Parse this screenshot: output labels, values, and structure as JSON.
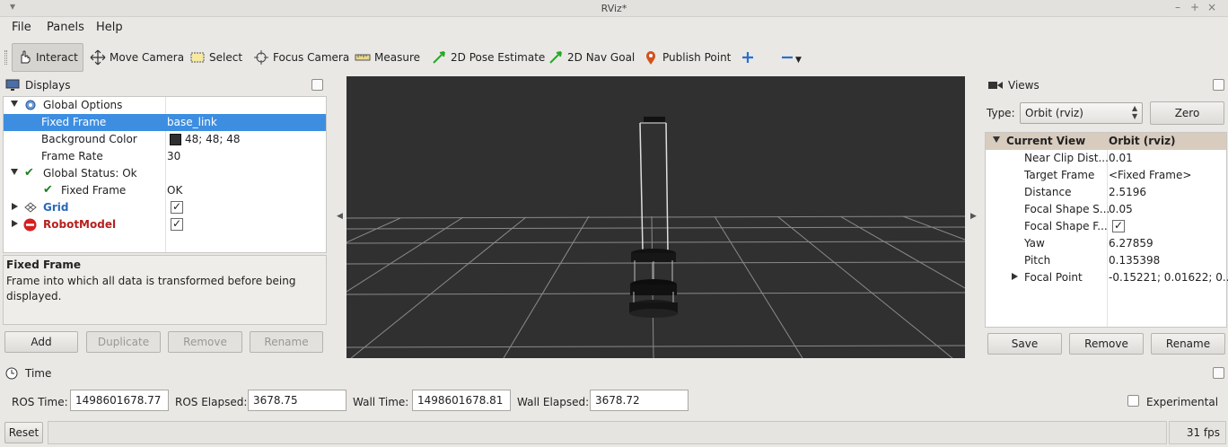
{
  "window": {
    "title": "RViz*"
  },
  "menu": {
    "file": "File",
    "panels": "Panels",
    "help": "Help"
  },
  "toolbar": {
    "interact": "Interact",
    "move_camera": "Move Camera",
    "select": "Select",
    "focus_camera": "Focus Camera",
    "measure": "Measure",
    "pose_estimate": "2D Pose Estimate",
    "nav_goal": "2D Nav Goal",
    "publish_point": "Publish Point"
  },
  "displays": {
    "title": "Displays",
    "global_options": "Global Options",
    "fixed_frame_label": "Fixed Frame",
    "fixed_frame_value": "base_link",
    "background_color_label": "Background Color",
    "background_color_value": "48; 48; 48",
    "background_color": "#303030",
    "frame_rate_label": "Frame Rate",
    "frame_rate_value": "30",
    "global_status": "Global Status: Ok",
    "status_fixed_frame_label": "Fixed Frame",
    "status_fixed_frame_value": "OK",
    "grid": "Grid",
    "robot_model": "RobotModel",
    "desc_title": "Fixed Frame",
    "desc_text": "Frame into which all data is transformed before being displayed.",
    "buttons": {
      "add": "Add",
      "duplicate": "Duplicate",
      "remove": "Remove",
      "rename": "Rename"
    }
  },
  "views": {
    "title": "Views",
    "type_label": "Type:",
    "type_value": "Orbit (rviz)",
    "zero": "Zero",
    "current_view": "Current View",
    "current_view_type": "Orbit (rviz)",
    "props": [
      {
        "label": "Near Clip Dist...",
        "value": "0.01"
      },
      {
        "label": "Target Frame",
        "value": "<Fixed Frame>"
      },
      {
        "label": "Distance",
        "value": "2.5196"
      },
      {
        "label": "Focal Shape S...",
        "value": "0.05"
      },
      {
        "label": "Focal Shape F...",
        "value": ""
      },
      {
        "label": "Yaw",
        "value": "6.27859"
      },
      {
        "label": "Pitch",
        "value": "0.135398"
      },
      {
        "label": "Focal Point",
        "value": "-0.15221; 0.01622; 0...."
      }
    ],
    "buttons": {
      "save": "Save",
      "remove": "Remove",
      "rename": "Rename"
    }
  },
  "time": {
    "title": "Time",
    "ros_time_label": "ROS Time:",
    "ros_time": "1498601678.77",
    "ros_elapsed_label": "ROS Elapsed:",
    "ros_elapsed": "3678.75",
    "wall_time_label": "Wall Time:",
    "wall_time": "1498601678.81",
    "wall_elapsed_label": "Wall Elapsed:",
    "wall_elapsed": "3678.72",
    "experimental": "Experimental"
  },
  "status": {
    "reset": "Reset",
    "fps": "31 fps"
  }
}
